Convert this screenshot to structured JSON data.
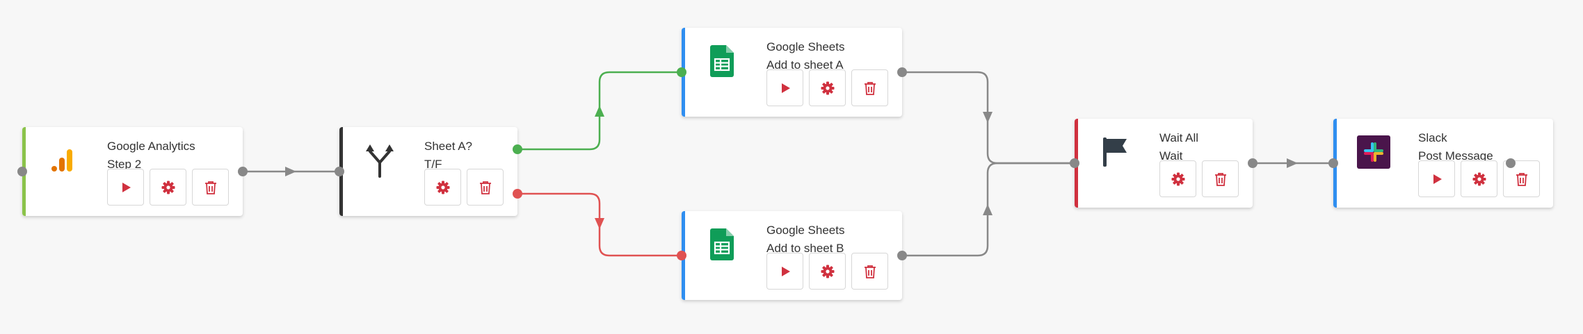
{
  "colors": {
    "canvas": "#f7f7f7",
    "wire": "#888888",
    "wire_true": "#4caf50",
    "wire_false": "#e05252",
    "button_icon": "#d0313f",
    "accent_analytics": "#8bc34a",
    "accent_condition": "#333333",
    "accent_sheets": "#2f8ef0",
    "accent_wait": "#d0313f",
    "accent_slack": "#2f8ef0"
  },
  "nodes": [
    {
      "id": "analytics",
      "title": "Google Analytics",
      "subtitle": "Step 2",
      "icon": "google-analytics-icon",
      "buttons": [
        "run",
        "settings",
        "delete"
      ]
    },
    {
      "id": "condition",
      "title": "Sheet A?",
      "subtitle": "T/F",
      "icon": "branch-icon",
      "buttons": [
        "settings",
        "delete"
      ]
    },
    {
      "id": "sheets_a",
      "title": "Google Sheets",
      "subtitle": "Add to sheet A",
      "icon": "google-sheets-icon",
      "buttons": [
        "run",
        "settings",
        "delete"
      ]
    },
    {
      "id": "sheets_b",
      "title": "Google Sheets",
      "subtitle": "Add to sheet B",
      "icon": "google-sheets-icon",
      "buttons": [
        "run",
        "settings",
        "delete"
      ]
    },
    {
      "id": "wait",
      "title": "Wait All",
      "subtitle": "Wait",
      "icon": "flag-icon",
      "buttons": [
        "settings",
        "delete"
      ]
    },
    {
      "id": "slack",
      "title": "Slack",
      "subtitle": "Post Message",
      "icon": "slack-icon",
      "buttons": [
        "run",
        "settings",
        "delete"
      ]
    }
  ],
  "connections": [
    {
      "from": "analytics",
      "to": "condition",
      "kind": "default"
    },
    {
      "from": "condition",
      "to": "sheets_a",
      "kind": "true"
    },
    {
      "from": "condition",
      "to": "sheets_b",
      "kind": "false"
    },
    {
      "from": "sheets_a",
      "to": "wait",
      "kind": "default"
    },
    {
      "from": "sheets_b",
      "to": "wait",
      "kind": "default"
    },
    {
      "from": "wait",
      "to": "slack",
      "kind": "default"
    }
  ]
}
